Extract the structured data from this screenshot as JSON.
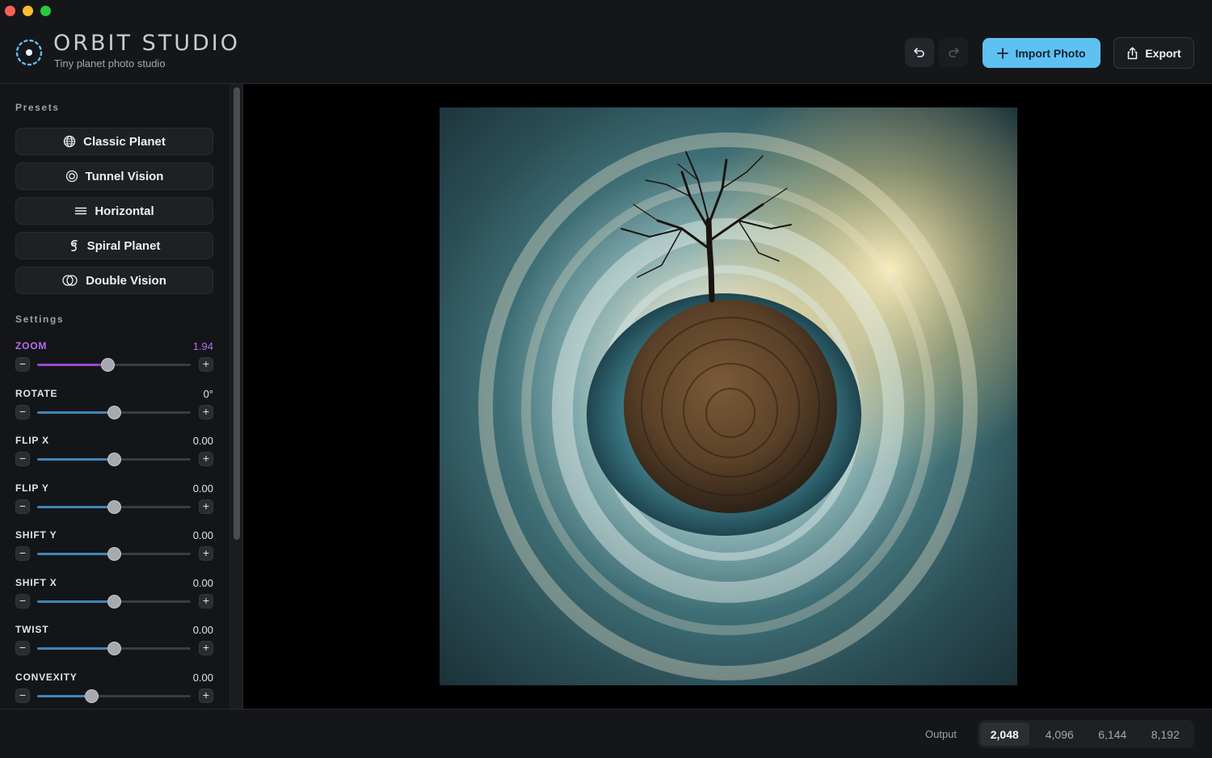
{
  "app": {
    "title": "ORBIT STUDIO",
    "subtitle": "Tiny planet photo studio",
    "accent": "#5ec1f2",
    "active_color": "#bb6de8"
  },
  "toolbar": {
    "undo_icon": "undo-icon",
    "redo_icon": "redo-icon",
    "import_label": "Import Photo",
    "export_label": "Export"
  },
  "presets": {
    "heading": "Presets",
    "items": [
      {
        "label": "Classic Planet",
        "icon": "globe-icon"
      },
      {
        "label": "Tunnel Vision",
        "icon": "target-icon"
      },
      {
        "label": "Horizontal",
        "icon": "lines-icon"
      },
      {
        "label": "Spiral Planet",
        "icon": "spiral-icon"
      },
      {
        "label": "Double Vision",
        "icon": "double-circle-icon"
      }
    ]
  },
  "settings": {
    "heading": "Settings",
    "items": [
      {
        "label": "ZOOM",
        "value": "1.94",
        "level": 0.46,
        "active": true
      },
      {
        "label": "ROTATE",
        "value": "0°",
        "level": 0.5,
        "active": false
      },
      {
        "label": "FLIP X",
        "value": "0.00",
        "level": 0.5,
        "active": false
      },
      {
        "label": "FLIP Y",
        "value": "0.00",
        "level": 0.5,
        "active": false
      },
      {
        "label": "SHIFT Y",
        "value": "0.00",
        "level": 0.5,
        "active": false
      },
      {
        "label": "SHIFT X",
        "value": "0.00",
        "level": 0.5,
        "active": false
      },
      {
        "label": "TWIST",
        "value": "0.00",
        "level": 0.5,
        "active": false
      },
      {
        "label": "CONVEXITY",
        "value": "0.00",
        "level": 0.35,
        "active": false
      }
    ]
  },
  "footer": {
    "output_label": "Output",
    "sizes": [
      "2,048",
      "4,096",
      "6,144",
      "8,192"
    ],
    "selected": "2,048"
  }
}
